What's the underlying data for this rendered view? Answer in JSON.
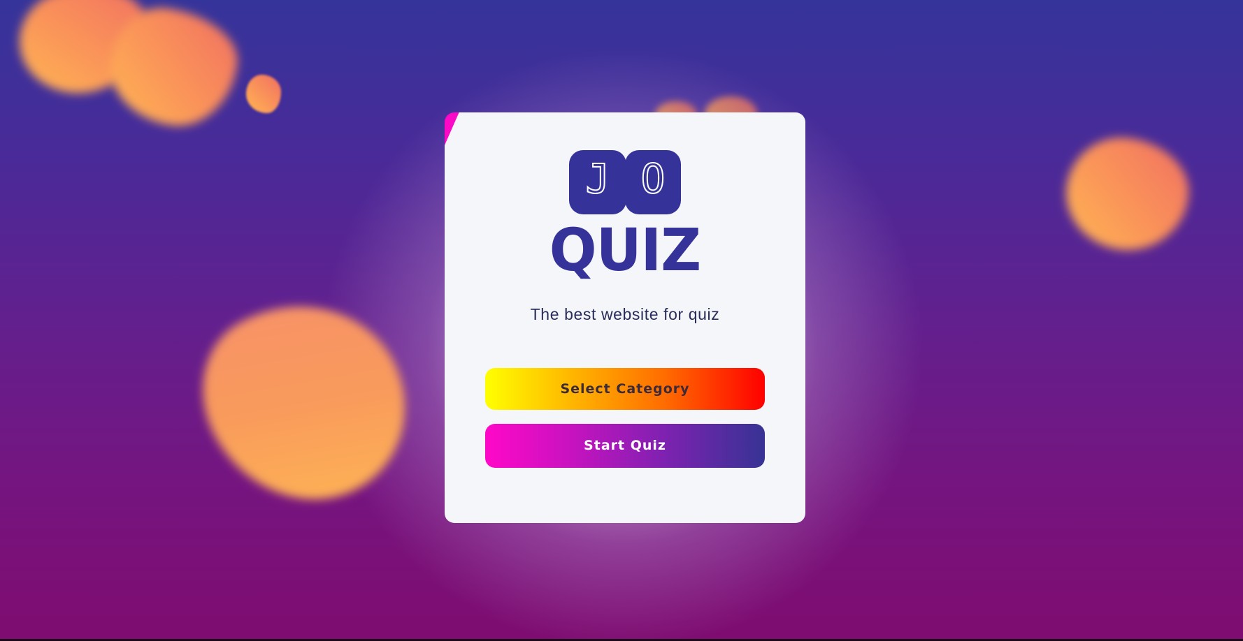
{
  "logo": {
    "letters": [
      "J",
      "O"
    ],
    "word": "QUIZ"
  },
  "tagline": "The best website for quiz",
  "buttons": {
    "select_category": "Select Category",
    "start_quiz": "Start Quiz"
  },
  "colors": {
    "brand": "#35339a",
    "card": "#f5f6fa",
    "accent_pink": "#ff08c8",
    "accent_yellow": "#ffff00",
    "accent_red": "#ff0000"
  }
}
